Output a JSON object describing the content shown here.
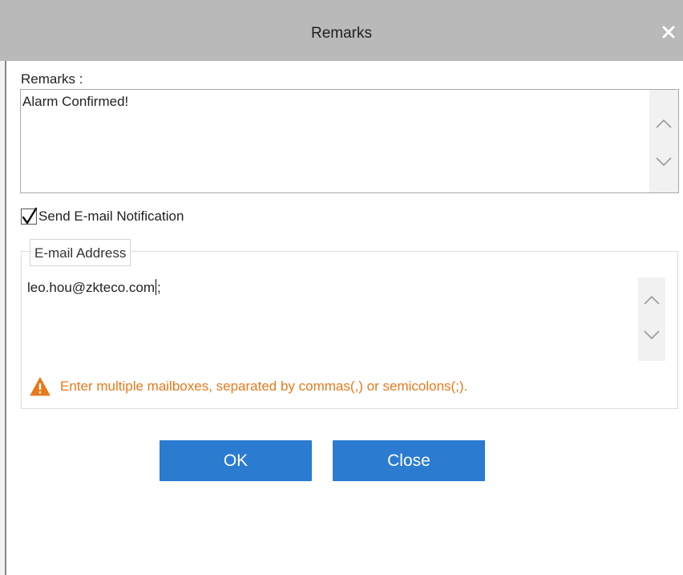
{
  "dialog": {
    "title": "Remarks",
    "close_icon": "close-icon"
  },
  "remarks": {
    "label": "Remarks :",
    "value": "Alarm Confirmed!"
  },
  "notification": {
    "checked": true,
    "label": "Send E-mail Notification"
  },
  "email": {
    "legend": "E-mail Address",
    "value_before_cursor": "leo.hou@zkteco.com",
    "value_after_cursor": ";",
    "warning_icon": "warning-icon",
    "warning": "Enter multiple mailboxes, separated by commas(,) or semicolons(;)."
  },
  "buttons": {
    "ok": "OK",
    "close": "Close"
  },
  "colors": {
    "titlebar": "#b9b9b9",
    "button": "#2b7bd1",
    "warning": "#e8791b"
  }
}
